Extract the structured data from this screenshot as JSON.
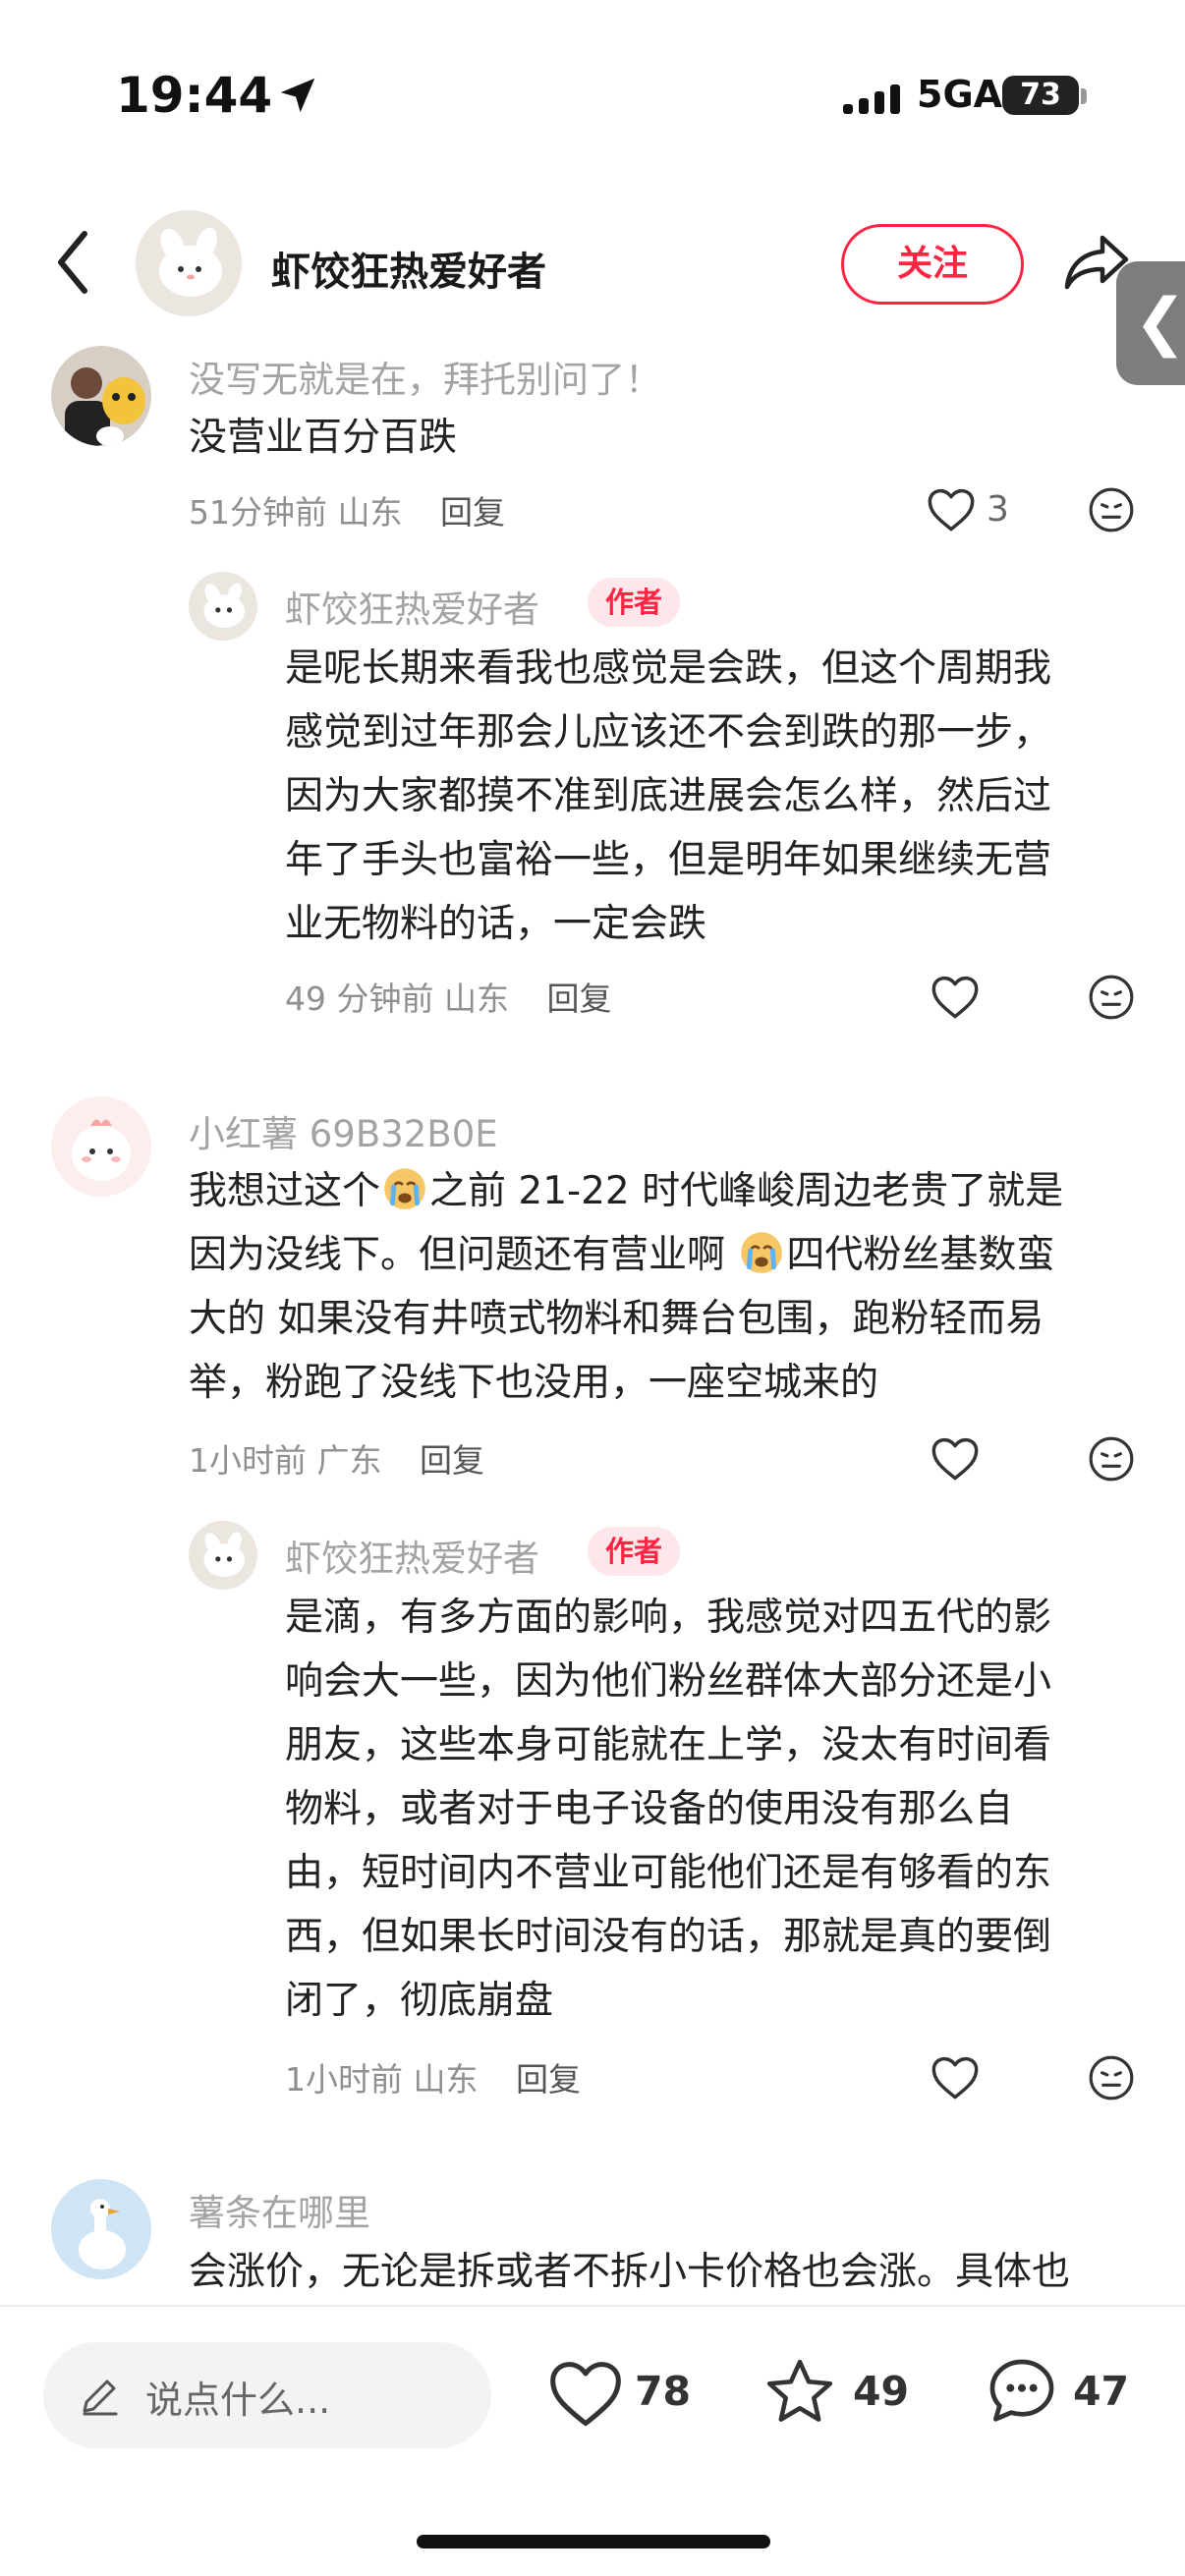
{
  "status_bar": {
    "time": "19:44",
    "network": "5GA",
    "battery": "73"
  },
  "header": {
    "username": "虾饺狂热爱好者",
    "follow_label": "关注"
  },
  "comments": [
    {
      "user": "没写无就是在，拜托别问了！",
      "text": "没营业百分百跌",
      "time": "51分钟前",
      "location": "山东",
      "reply_label": "回复",
      "likes": "3",
      "reply": {
        "user": "虾饺狂热爱好者",
        "badge": "作者",
        "lines": [
          "是呢长期来看我也感觉是会跌，但这个周期我",
          "感觉到过年那会儿应该还不会到跌的那一步，",
          "因为大家都摸不准到底进展会怎么样，然后过",
          "年了手头也富裕一些，但是明年如果继续无营",
          "业无物料的话，一定会跌"
        ],
        "time": "49 分钟前",
        "location": "山东",
        "reply_label": "回复"
      }
    },
    {
      "user": "小红薯 69B32B0E",
      "lines": [
        {
          "a": "我想过这个",
          "b": "之前 21-22 时代峰峻周边老贵了就是"
        },
        {
          "a": "因为没线下。但问题还有营业啊 ",
          "b": "四代粉丝基数蛮"
        },
        {
          "a": "大的 如果没有井喷式物料和舞台包围，跑粉轻而易"
        },
        {
          "a": "举，粉跑了没线下也没用，一座空城来的"
        }
      ],
      "time": "1小时前",
      "location": "广东",
      "reply_label": "回复",
      "reply": {
        "user": "虾饺狂热爱好者",
        "badge": "作者",
        "lines": [
          "是滴，有多方面的影响，我感觉对四五代的影",
          "响会大一些，因为他们粉丝群体大部分还是小",
          "朋友，这些本身可能就在上学，没太有时间看",
          "物料，或者对于电子设备的使用没有那么自",
          "由，短时间内不营业可能他们还是有够看的东",
          "西，但如果长时间没有的话，那就是真的要倒",
          "闭了，彻底崩盘"
        ],
        "time": "1小时前",
        "location": "山东",
        "reply_label": "回复"
      }
    },
    {
      "user": "薯条在哪里",
      "text": "会涨价，无论是拆或者不拆小卡价格也会涨。具体也"
    }
  ],
  "bottom_bar": {
    "input_placeholder": "说点什么...",
    "likes": "78",
    "stars": "49",
    "comments": "47"
  },
  "icons": {
    "back": "chevron-left-icon",
    "share": "share-arrow-icon",
    "like": "heart-icon",
    "dislike": "meh-face-icon",
    "edit": "pencil-icon",
    "star": "star-icon",
    "comment": "chat-bubble-icon",
    "crying_emoji": "crying-face-emoji"
  },
  "colors": {
    "accent": "#ff2442",
    "badge_bg": "#fde7ea",
    "meta": "#8f8f8f"
  }
}
